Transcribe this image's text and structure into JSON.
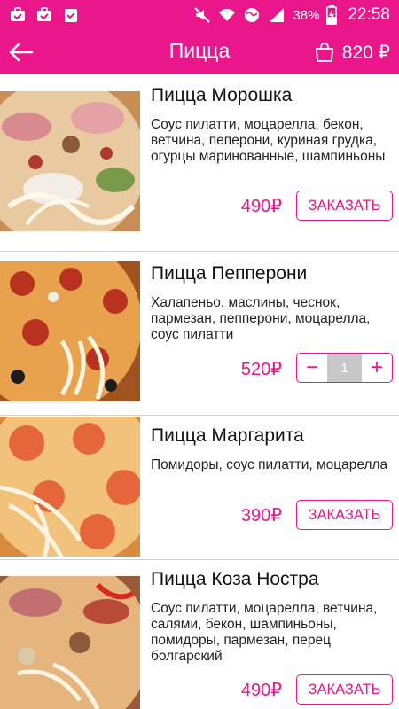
{
  "colors": {
    "accent": "#e9168c",
    "stepper_qty_bg": "#c7c7c7"
  },
  "status_bar": {
    "left_icons": [
      "briefcase-check-icon",
      "briefcase-check-icon",
      "clipboard-check-icon"
    ],
    "battery_percent": "38%",
    "time": "22:58"
  },
  "app_bar": {
    "back_icon": "arrow-left-icon",
    "title": "Пицца",
    "cart_icon": "shopping-bag-icon",
    "cart_total": "820 ₽"
  },
  "products": [
    {
      "name": "Пицца Морошка",
      "description": "Соус пилатти, моцарелла, бекон, ветчина, пеперони, куриная грудка, огурцы маринованные, шампиньоны",
      "price": "490₽",
      "action": "ЗАКАЗАТЬ"
    },
    {
      "name": "Пицца Пепперони",
      "description": "Халапеньо, маслины, чеснок, пармезан, пепперони, моцарелла, соус пилатти",
      "price": "520₽",
      "quantity": "1",
      "minus": "−",
      "plus": "+"
    },
    {
      "name": "Пицца Маргарита",
      "description": "Помидоры, соус пилатти, моцарелла",
      "price": "390₽",
      "action": "ЗАКАЗАТЬ"
    },
    {
      "name": "Пицца Коза Ностра",
      "description": "Соус пилатти, моцарелла, ветчина, салями, бекон, шампиньоны, помидоры, пармезан, перец болгарский",
      "price": "490₽",
      "action": "ЗАКАЗАТЬ"
    }
  ]
}
